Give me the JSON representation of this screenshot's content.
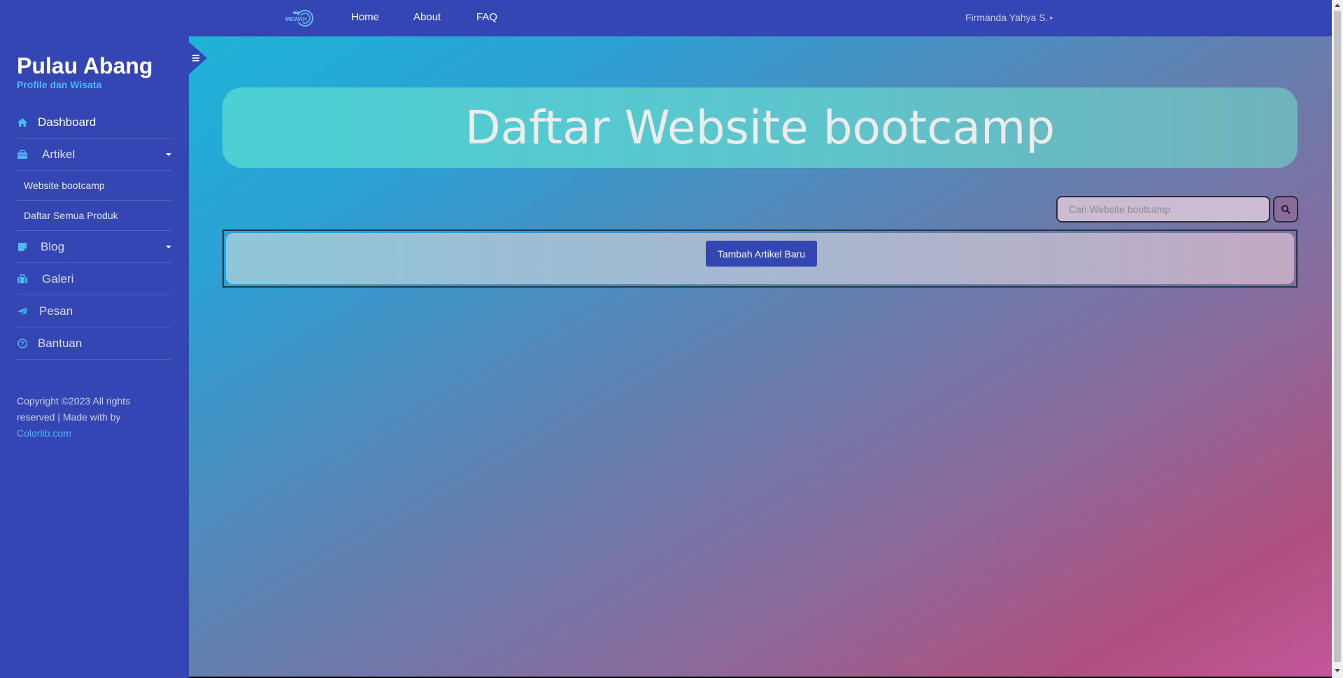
{
  "navbar": {
    "logo_text": "MEWAH",
    "links": [
      "Home",
      "About",
      "FAQ"
    ],
    "user_name": "Firmanda Yahya S."
  },
  "sidebar": {
    "title": "Pulau Abang",
    "subtitle": "Profile dan Wisata",
    "items": [
      {
        "label": "Dashboard",
        "icon": "home-icon"
      },
      {
        "label": "Artikel",
        "icon": "briefcase-icon",
        "has_caret": true
      },
      {
        "label": "Blog",
        "icon": "sticky-note-icon",
        "has_caret": true
      },
      {
        "label": "Galeri",
        "icon": "suitcase-icon"
      },
      {
        "label": "Pesan",
        "icon": "paper-plane-icon"
      },
      {
        "label": "Bantuan",
        "icon": "question-circle-icon"
      }
    ],
    "subitems": [
      "Website bootcamp",
      "Daftar Semua Produk"
    ],
    "footer": {
      "text": "Copyright ©2023 All rights reserved | Made with by",
      "link": "Colorlib.com"
    }
  },
  "main": {
    "hero_title": "Daftar Website bootcamp",
    "search": {
      "placeholder": "Cari Website bootcamp",
      "value": ""
    },
    "add_button_label": "Tambah Artikel Baru"
  },
  "colors": {
    "primary": "#3445b4",
    "accent": "#4fb8f3"
  }
}
